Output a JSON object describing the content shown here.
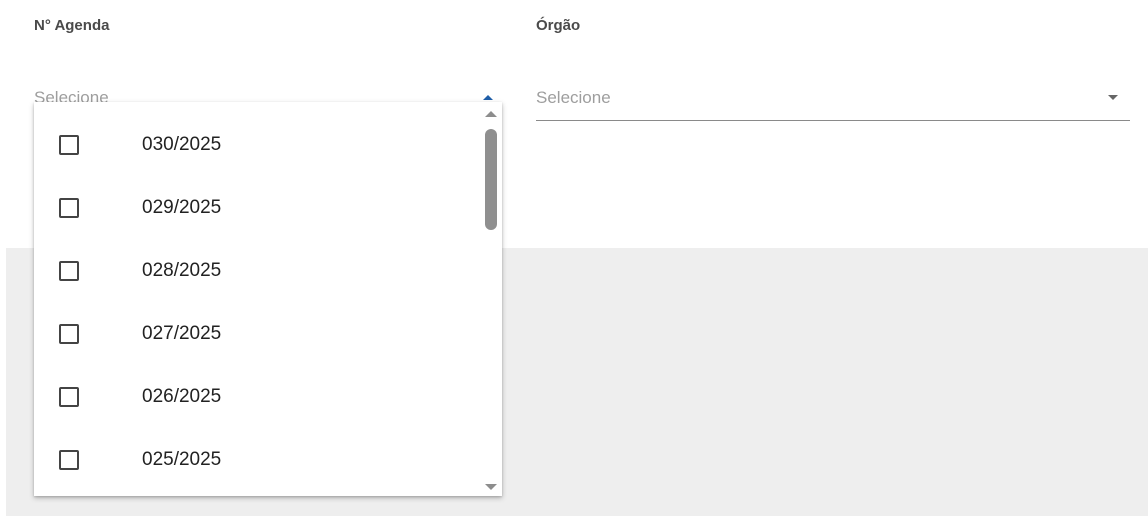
{
  "fields": {
    "agenda": {
      "label": "N° Agenda",
      "placeholder": "Selecione",
      "expanded": true
    },
    "orgao": {
      "label": "Órgão",
      "placeholder": "Selecione",
      "expanded": false
    }
  },
  "dropdown": {
    "options": [
      {
        "label": "030/2025",
        "checked": false
      },
      {
        "label": "029/2025",
        "checked": false
      },
      {
        "label": "028/2025",
        "checked": false
      },
      {
        "label": "027/2025",
        "checked": false
      },
      {
        "label": "026/2025",
        "checked": false
      },
      {
        "label": "025/2025",
        "checked": false
      }
    ]
  },
  "colors": {
    "accent_arrow": "#1f5ea8",
    "gray_background": "#eeeeee",
    "placeholder_text": "#9e9e9e"
  }
}
